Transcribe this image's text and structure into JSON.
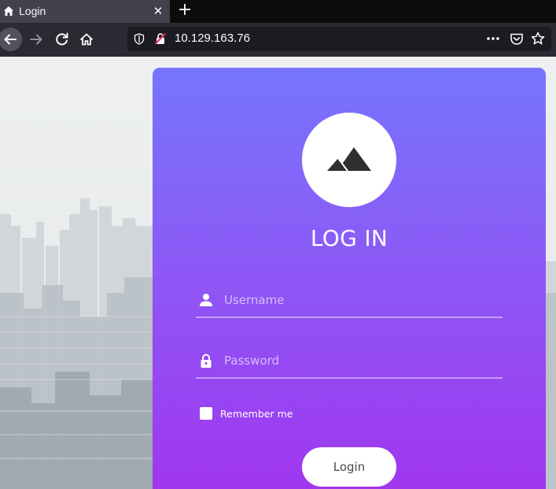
{
  "browser": {
    "tab": {
      "title": "Login",
      "close_glyph": "✕",
      "icon": "home-icon"
    },
    "new_tab_glyph": "+",
    "nav": {
      "back_icon": "arrow-left-icon",
      "forward_icon": "arrow-right-icon",
      "reload_icon": "reload-icon",
      "home_icon": "home-icon"
    },
    "url": "10.129.163.76",
    "url_icons": [
      "shield-icon",
      "insecure-lock-icon",
      "more-icon",
      "pocket-icon",
      "star-icon"
    ]
  },
  "login": {
    "title": "LOG IN",
    "username": {
      "placeholder": "Username",
      "value": "",
      "icon": "user-icon"
    },
    "password": {
      "placeholder": "Password",
      "value": "",
      "icon": "lock-icon"
    },
    "remember_label": "Remember me",
    "remember_checked": false,
    "submit_label": "Login",
    "avatar_icon": "mountain-icon"
  },
  "colors": {
    "gradient_top": "#7675ff",
    "gradient_bottom": "#a133ee",
    "chrome_dark": "#2b2a33",
    "url_bg": "#1c1b22"
  }
}
